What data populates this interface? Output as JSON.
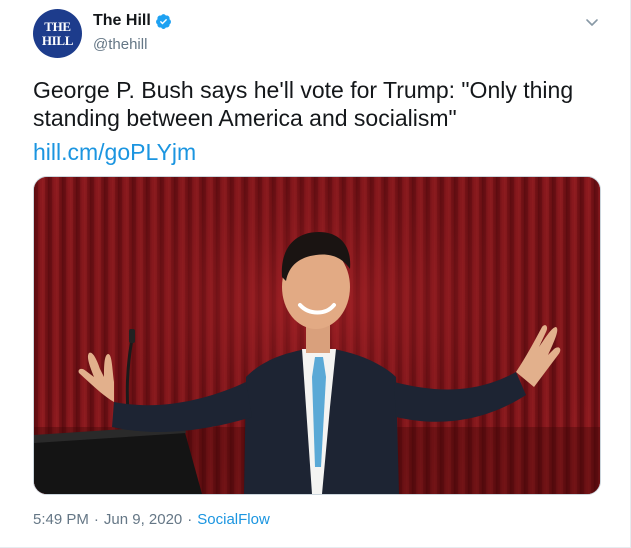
{
  "account": {
    "avatar_line1": "THE",
    "avatar_line2": "HILL",
    "display_name": "The Hill",
    "handle": "@thehill",
    "verified": true
  },
  "tweet": {
    "text": "George P. Bush says he'll vote for Trump: \"Only thing standing between America and socialism\"",
    "link": "hill.cm/goPLYjm"
  },
  "meta": {
    "time": "5:49 PM",
    "separator1": "·",
    "date": "Jun 9, 2020",
    "separator2": "·",
    "source": "SocialFlow"
  },
  "icons": {
    "verified": "verified-badge-icon",
    "menu": "chevron-down-icon"
  },
  "colors": {
    "link": "#1b95e0",
    "secondary_text": "#657786",
    "verified": "#1da1f2",
    "avatar_bg": "#1d3c8c"
  }
}
